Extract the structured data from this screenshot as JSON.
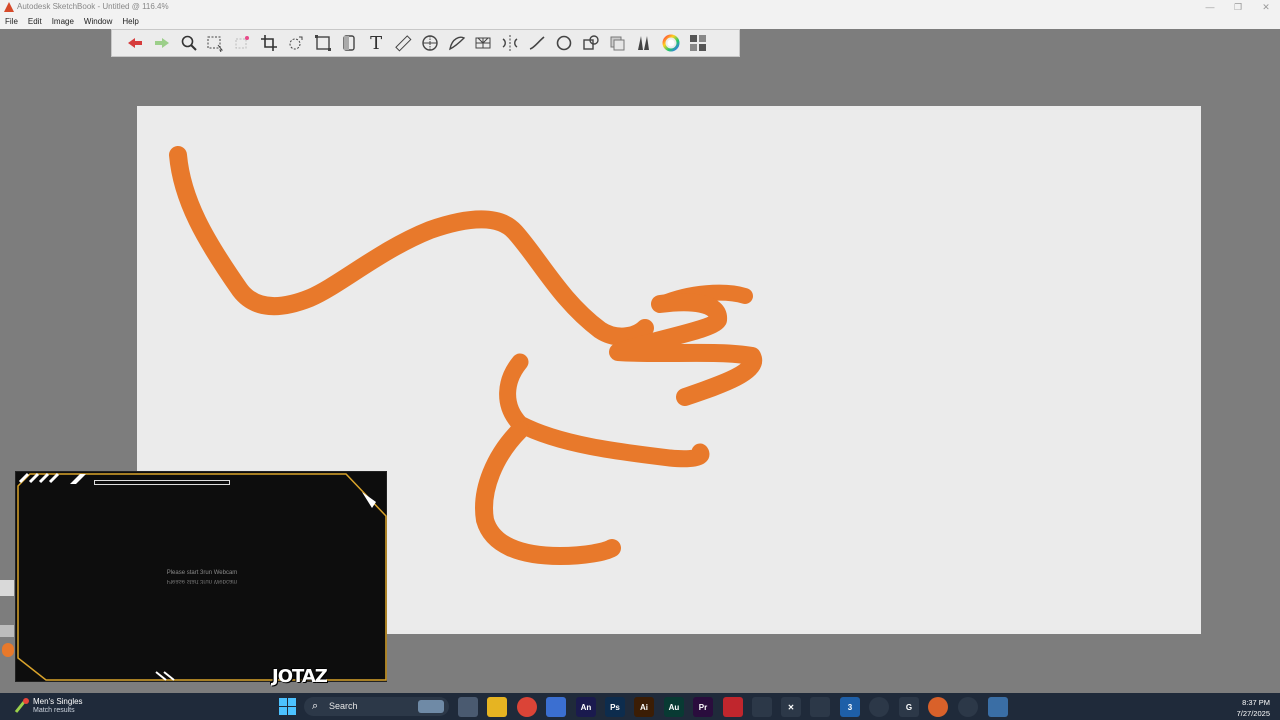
{
  "window": {
    "title": "Autodesk SketchBook - Untitled @ 116.4%",
    "controls": [
      "—",
      "❐",
      "✕"
    ]
  },
  "menu": [
    "File",
    "Edit",
    "Image",
    "Window",
    "Help"
  ],
  "toolbar": {
    "tools": [
      "undo-icon",
      "redo-icon",
      "zoom-icon",
      "select-icon",
      "lasso-select-icon",
      "crop-icon",
      "transform-icon",
      "distort-icon",
      "canvas-flip-icon",
      "text-icon",
      "ruler-icon",
      "ellipse-guide-icon",
      "french-curve-icon",
      "perspective-icon",
      "symmetry-icon",
      "stroke-icon",
      "circle-icon",
      "shape-icon",
      "layers-icon",
      "brush-library-icon",
      "color-wheel-icon",
      "copic-library-icon"
    ],
    "text_tool_label": "T"
  },
  "canvas": {
    "background": "#ebebeb",
    "stroke_color": "#e8792b"
  },
  "webcam": {
    "message": "Please start 3run Webcam",
    "logo": "JOTAZ"
  },
  "taskbar": {
    "notification_title": "Men's Singles",
    "notification_subtitle": "Match results",
    "search_label": "Search",
    "apps": [
      {
        "name": "task-view",
        "label": "",
        "color": "#4a5a70"
      },
      {
        "name": "file-explorer",
        "label": "",
        "color": "#e6b422"
      },
      {
        "name": "chrome",
        "label": "",
        "color": "#db4437"
      },
      {
        "name": "app-vs",
        "label": "",
        "color": "#3b6fd1"
      },
      {
        "name": "animate",
        "label": "An",
        "color": "#1a1a4e"
      },
      {
        "name": "photoshop",
        "label": "Ps",
        "color": "#0d2c4d"
      },
      {
        "name": "illustrator",
        "label": "Ai",
        "color": "#3b1d05"
      },
      {
        "name": "audition",
        "label": "Au",
        "color": "#083a33"
      },
      {
        "name": "premiere",
        "label": "Pr",
        "color": "#2a0d3d"
      },
      {
        "name": "app-red",
        "label": "",
        "color": "#c0262d"
      },
      {
        "name": "app-pencil",
        "label": "",
        "color": "#2c3848"
      },
      {
        "name": "app-x",
        "label": "✕",
        "color": "#2c3848"
      },
      {
        "name": "app-doc",
        "label": "",
        "color": "#2c3848"
      },
      {
        "name": "app-3",
        "label": "3",
        "color": "#1e5fa8"
      },
      {
        "name": "app-circle",
        "label": "",
        "color": "#2c3848"
      },
      {
        "name": "app-g",
        "label": "G",
        "color": "#2c3848"
      },
      {
        "name": "app-orange",
        "label": "",
        "color": "#d9612a"
      },
      {
        "name": "obs",
        "label": "",
        "color": "#2c3848"
      },
      {
        "name": "sketchbook",
        "label": "",
        "color": "#3a6ea5"
      }
    ],
    "time": "8:37 PM",
    "date": "7/27/2025"
  }
}
